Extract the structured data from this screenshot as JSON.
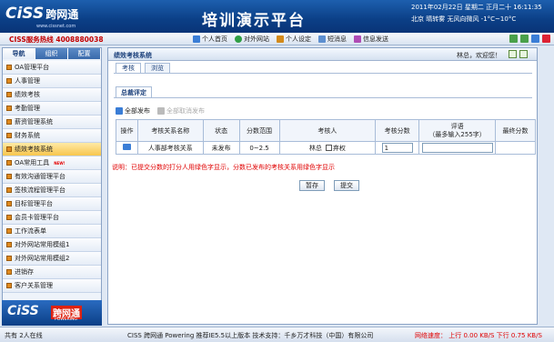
{
  "banner": {
    "logo": "CiSS",
    "logo_cn": "跨网通",
    "logo_url": "www.cissnet.com",
    "title": "培训演示平台",
    "datetime": "2011年02月22日  星期二  正月二十  16:11:35",
    "weather": "北京  晴转雾  无风向微风  -1°C~10°C"
  },
  "topbar": {
    "hotline": "CISS服务热线  4008880038",
    "nav": [
      "个人首页",
      "对外网站",
      "个人设定",
      "短消息",
      "信息发送"
    ],
    "nav_icons": [
      "home-icon",
      "globe-icon",
      "user-settings-icon",
      "message-icon",
      "send-icon"
    ]
  },
  "sidebar": {
    "tabs": [
      "导航",
      "组织",
      "配置"
    ],
    "items": [
      {
        "label": "OA管理平台"
      },
      {
        "label": "人事管理"
      },
      {
        "label": "绩效考核"
      },
      {
        "label": "考勤管理"
      },
      {
        "label": "薪资管理系统"
      },
      {
        "label": "财务系统"
      },
      {
        "label": "绩效考核系统"
      },
      {
        "label": "OA常用工具",
        "badge": "NEW!"
      },
      {
        "label": "有效沟通管理平台"
      },
      {
        "label": "签核流程管理平台"
      },
      {
        "label": "目标管理平台"
      },
      {
        "label": "会员卡管理平台"
      },
      {
        "label": "工作流表单"
      },
      {
        "label": "对外网站常用模组1"
      },
      {
        "label": "对外网站常用模组2"
      },
      {
        "label": "进销存"
      },
      {
        "label": "客户关系管理"
      }
    ],
    "logo_text": "CiSS",
    "logo_cn": "跨网通",
    "logo_sub": "POWERING"
  },
  "content": {
    "title": "绩效考核系统",
    "welcome": "林总，欢迎您！",
    "subtabs": [
      "考核",
      "浏览"
    ],
    "section": "总裁评定",
    "actions": {
      "publish_all": "全部发布",
      "unpublish_all": "全部取消发布"
    },
    "table": {
      "headers": [
        "操作",
        "考核关系名称",
        "状态",
        "分数范围",
        "考核人",
        "考核分数",
        "评语\n（最多输入255字）",
        "最终分数"
      ],
      "rows": [
        {
          "name": "人事部考核关系",
          "status": "未发布",
          "range": "0~2.5",
          "assessor": "林总",
          "abstain": "弃权",
          "score": "1",
          "comment": "",
          "final": ""
        }
      ]
    },
    "note": "说明：已提交分数的打分人用绿色字显示，分数已发布的考核关系用绿色字显示",
    "buttons": {
      "save": "暂存",
      "submit": "提交"
    }
  },
  "status": {
    "online": "共有 2人在线",
    "center": "CISS 跨网通 Powering    推荐IE5.5以上版本    技术支持：千乡万才科技（中国）有限公司",
    "speed": "网络速度：  上行  0.00 KB/S  下行  0.75 KB/S"
  },
  "colors": {
    "banner": "#0b3f86",
    "accent": "#e08a1e",
    "alert": "#e00000"
  }
}
